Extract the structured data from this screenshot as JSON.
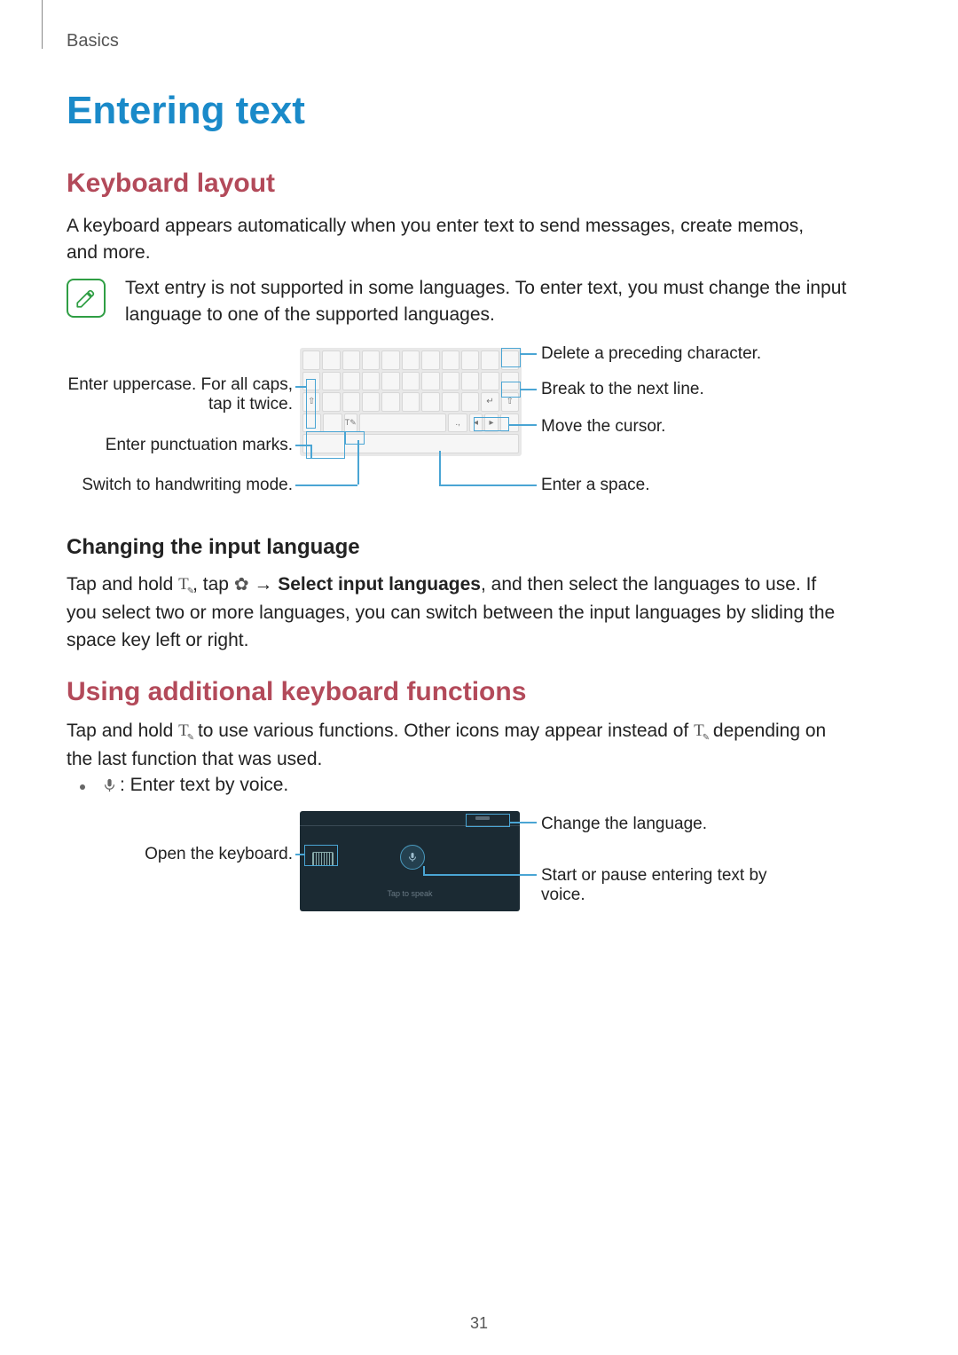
{
  "header": {
    "section": "Basics"
  },
  "title": "Entering text",
  "section1": {
    "title": "Keyboard layout",
    "p1": "A keyboard appears automatically when you enter text to send messages, create memos, and more.",
    "note": "Text entry is not supported in some languages. To enter text, you must change the input language to one of the supported languages."
  },
  "kb_labels": {
    "left1a": "Enter uppercase. For all caps,",
    "left1b": "tap it twice.",
    "left2": "Enter punctuation marks.",
    "left3": "Switch to handwriting mode.",
    "right1": "Delete a preceding character.",
    "right2": "Break to the next line.",
    "right3": "Move the cursor.",
    "right4": "Enter a space."
  },
  "subsection1": {
    "title": "Changing the input language",
    "p_pre": "Tap and hold ",
    "p_mid1": ", tap ",
    "p_arrow": " → ",
    "p_bold": "Select input languages",
    "p_post": ", and then select the languages to use. If you select two or more languages, you can switch between the input languages by sliding the space key left or right."
  },
  "section2": {
    "title": "Using additional keyboard functions",
    "p_pre": "Tap and hold ",
    "p_mid": " to use various functions. Other icons may appear instead of ",
    "p_post": " depending on the last function that was used.",
    "bullet_text": " : Enter text by voice."
  },
  "voice_labels": {
    "left": "Open the keyboard.",
    "right1": "Change the language.",
    "right2": "Start or pause entering text by voice.",
    "tap": "Tap to speak"
  },
  "page_number": "31"
}
